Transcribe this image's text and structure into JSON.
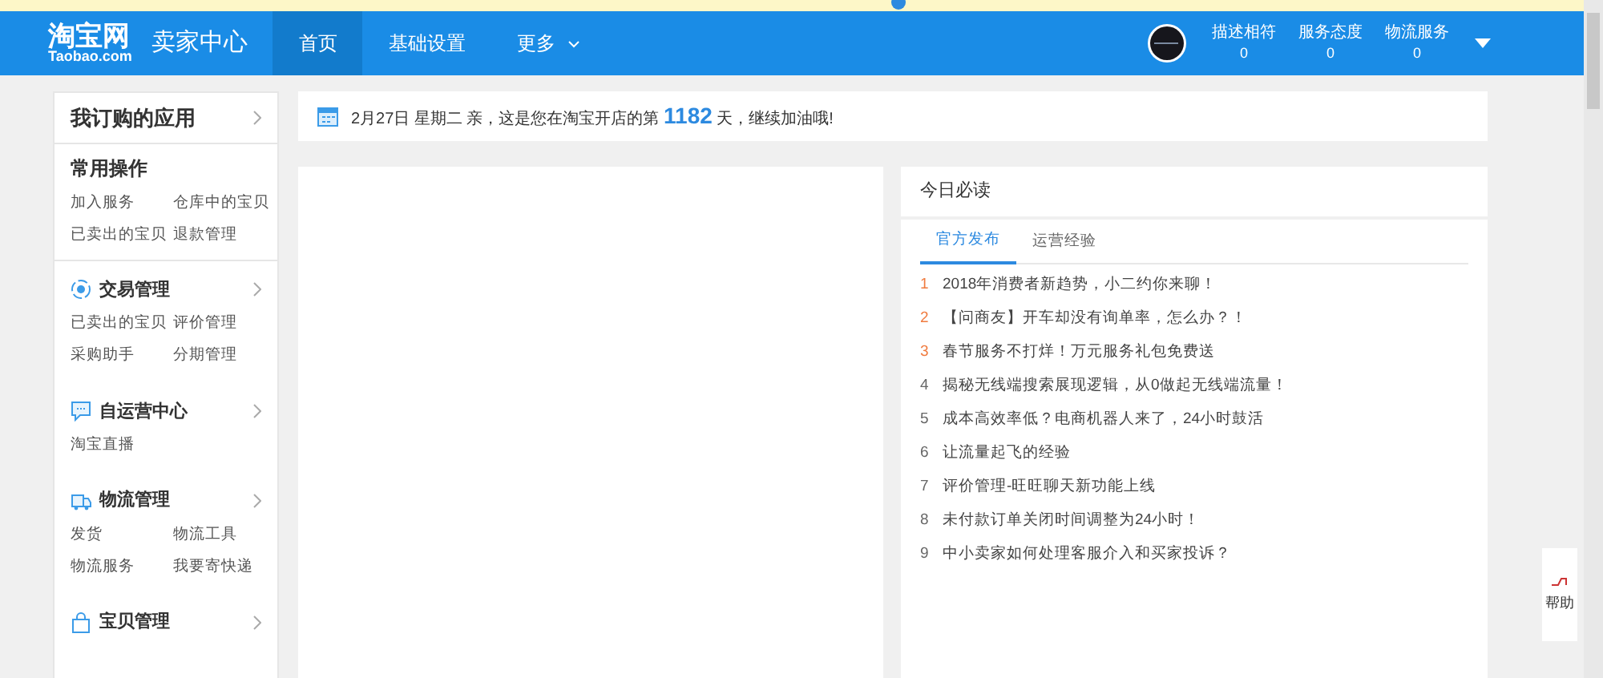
{
  "topbar": {
    "logo": {
      "cn": "淘宝网",
      "en": "Taobao.com"
    },
    "title": "卖家中心",
    "nav": [
      {
        "label": "首页",
        "selected": true,
        "dropdown": false
      },
      {
        "label": "基础设置",
        "selected": false,
        "dropdown": false
      },
      {
        "label": "更多",
        "selected": false,
        "dropdown": true
      }
    ],
    "stats": [
      {
        "label": "描述相符",
        "value": "0"
      },
      {
        "label": "服务态度",
        "value": "0"
      },
      {
        "label": "物流服务",
        "value": "0"
      }
    ]
  },
  "sidebar": {
    "header": "我订购的应用",
    "common": {
      "title": "常用操作",
      "links": [
        "加入服务",
        "仓库中的宝贝",
        "已卖出的宝贝",
        "退款管理"
      ]
    },
    "sections": [
      {
        "kind": "trade",
        "title": "交易管理",
        "links": [
          "已卖出的宝贝",
          "评价管理",
          "采购助手",
          "分期管理"
        ]
      },
      {
        "kind": "chat",
        "title": "自运营中心",
        "links": [
          "淘宝直播"
        ]
      },
      {
        "kind": "truck",
        "title": "物流管理",
        "links": [
          "发货",
          "物流工具",
          "物流服务",
          "我要寄快递"
        ]
      },
      {
        "kind": "bag",
        "title": "宝贝管理"
      }
    ]
  },
  "greeting": {
    "before": "2月27日 星期二  亲，这是您在淘宝开店的第",
    "days": "1182",
    "after": "天，继续加油哦!"
  },
  "must_read": {
    "title": "今日必读",
    "tabs": [
      {
        "label": "官方发布",
        "selected": true
      },
      {
        "label": "运营经验",
        "selected": false
      }
    ],
    "items": [
      {
        "rank": "1",
        "text": "2018年消费者新趋势，小二约你来聊！",
        "color": "#f07b3f"
      },
      {
        "rank": "2",
        "text": "【问商友】开车却没有询单率，怎么办？！",
        "color": "#f07b3f"
      },
      {
        "rank": "3",
        "text": "春节服务不打烊！万元服务礼包免费送",
        "color": "#f07b3f"
      },
      {
        "rank": "4",
        "text": "揭秘无线端搜索展现逻辑，从0做起无线端流量！",
        "color": "#666666"
      },
      {
        "rank": "5",
        "text": "成本高效率低？电商机器人来了，24小时鼓活",
        "color": "#666666"
      },
      {
        "rank": "6",
        "text": "让流量起飞的经验",
        "color": "#666666"
      },
      {
        "rank": "7",
        "text": "评价管理-旺旺聊天新功能上线",
        "color": "#666666"
      },
      {
        "rank": "8",
        "text": "未付款订单关闭时间调整为24小时！",
        "color": "#666666"
      },
      {
        "rank": "9",
        "text": "中小卖家如何处理客服介入和买家投诉？",
        "color": "#666666"
      }
    ]
  },
  "help": {
    "label": "帮助"
  }
}
